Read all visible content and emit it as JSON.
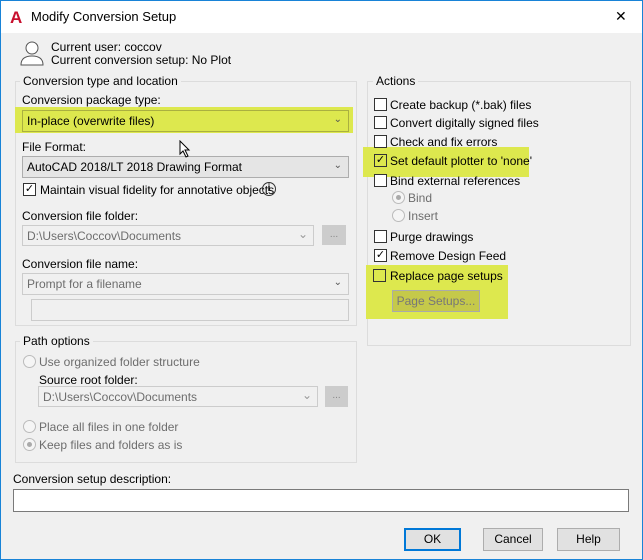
{
  "window": {
    "title": "Modify Conversion Setup",
    "close": "✕"
  },
  "user": {
    "line1": "Current user: coccov",
    "line2": "Current conversion setup: No Plot"
  },
  "conversion": {
    "group_label": "Conversion type and location",
    "package_label": "Conversion package type:",
    "package_value": "In-place (overwrite files)",
    "format_label": "File Format:",
    "format_value": "AutoCAD 2018/LT 2018 Drawing Format",
    "fidelity_label": "Maintain visual fidelity for annotative objects",
    "fidelity_checked": true,
    "folder_label": "Conversion file folder:",
    "folder_value": "D:\\Users\\Coccov\\Documents",
    "browse": "...",
    "name_label": "Conversion file name:",
    "name_value": "Prompt for a filename",
    "name_input": ""
  },
  "path": {
    "group_label": "Path options",
    "organized": "Use organized folder structure",
    "source_label": "Source root folder:",
    "source_value": "D:\\Users\\Coccov\\Documents",
    "browse": "...",
    "one_folder": "Place all files in one folder",
    "keep": "Keep files and folders as is"
  },
  "actions": {
    "group_label": "Actions",
    "items": [
      {
        "label": "Create backup (*.bak) files",
        "checked": false
      },
      {
        "label": "Convert digitally signed files",
        "checked": false
      },
      {
        "label": "Check and fix errors",
        "checked": false
      },
      {
        "label": "Set default plotter to 'none'",
        "checked": true
      },
      {
        "label": "Bind external references",
        "checked": false
      },
      {
        "label": "Purge drawings",
        "checked": false
      },
      {
        "label": "Remove Design Feed",
        "checked": true
      },
      {
        "label": "Replace page setups",
        "checked": false
      }
    ],
    "bind": "Bind",
    "insert": "Insert",
    "page_setups": "Page Setups..."
  },
  "description": {
    "label": "Conversion setup description:",
    "value": ""
  },
  "buttons": {
    "ok": "OK",
    "cancel": "Cancel",
    "help": "Help"
  },
  "colors": {
    "highlight": "#dde84e",
    "accent": "#1883d7"
  }
}
